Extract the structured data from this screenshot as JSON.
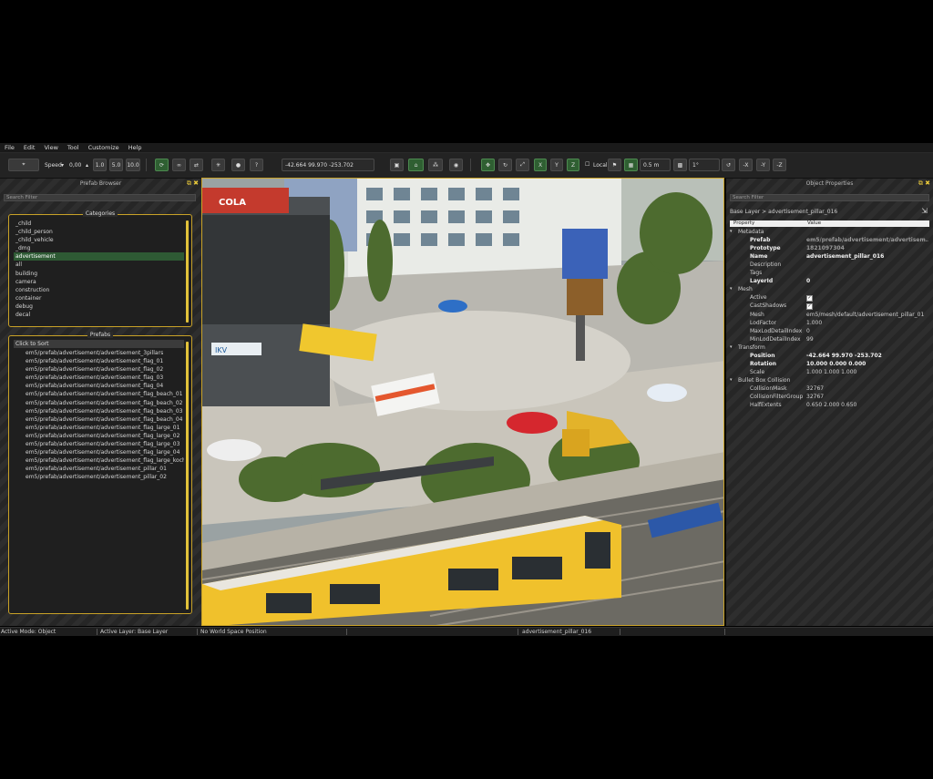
{
  "menu": [
    "File",
    "Edit",
    "View",
    "Tool",
    "Customize",
    "Help"
  ],
  "toolbar": {
    "speed_label": "Speed",
    "speed_value": "0,00",
    "speed_presets": [
      "1.0",
      "5.0",
      "10.0"
    ],
    "help": "?",
    "coords": "-42.664 99.970 -253.702",
    "axis_x": "X",
    "axis_y": "Y",
    "axis_z": "Z",
    "local_label": "Local",
    "grid_size": "0.5 m",
    "angle_snap": "1°",
    "neg_x": "-X",
    "neg_y": "-Y",
    "neg_z": "-Z"
  },
  "prefab_browser": {
    "title": "Prefab Browser",
    "search_placeholder": "Search Filter",
    "categories_title": "Categories",
    "categories": [
      "_child",
      "_child_person",
      "_child_vehicle",
      "_dmg",
      "advertisement",
      "all",
      "building",
      "camera",
      "construction",
      "container",
      "debug",
      "decal"
    ],
    "selected_category": "advertisement",
    "prefabs_title": "Prefabs",
    "sort_label": "Click to Sort",
    "prefabs": [
      "em5/prefab/advertisement/advertisement_3pillars",
      "em5/prefab/advertisement/advertisement_flag_01",
      "em5/prefab/advertisement/advertisement_flag_02",
      "em5/prefab/advertisement/advertisement_flag_03",
      "em5/prefab/advertisement/advertisement_flag_04",
      "em5/prefab/advertisement/advertisement_flag_beach_01",
      "em5/prefab/advertisement/advertisement_flag_beach_02",
      "em5/prefab/advertisement/advertisement_flag_beach_03",
      "em5/prefab/advertisement/advertisement_flag_beach_04",
      "em5/prefab/advertisement/advertisement_flag_large_01",
      "em5/prefab/advertisement/advertisement_flag_large_02",
      "em5/prefab/advertisement/advertisement_flag_large_03",
      "em5/prefab/advertisement/advertisement_flag_large_04",
      "em5/prefab/advertisement/advertisement_flag_large_koch",
      "em5/prefab/advertisement/advertisement_pillar_01",
      "em5/prefab/advertisement/advertisement_pillar_02"
    ]
  },
  "viewport": {
    "signs": {
      "cola": "COLA",
      "shop": "IKV"
    }
  },
  "object_properties": {
    "title": "Object Properties",
    "search_placeholder": "Search Filter",
    "breadcrumb": "Base Layer > advertisement_pillar_016",
    "col_property": "Property",
    "col_value": "Value",
    "rows": [
      {
        "type": "section",
        "key": "Metadata"
      },
      {
        "type": "prop",
        "key": "Prefab",
        "value": "em5/prefab/advertisement/advertisem...",
        "bold": true,
        "dim": true
      },
      {
        "type": "prop",
        "key": "Prototype",
        "value": "1821097304",
        "bold": true,
        "dim": true
      },
      {
        "type": "prop",
        "key": "Name",
        "value": "advertisement_pillar_016",
        "bold": true
      },
      {
        "type": "prop",
        "key": "Description",
        "value": ""
      },
      {
        "type": "prop",
        "key": "Tags",
        "value": ""
      },
      {
        "type": "prop",
        "key": "LayerId",
        "value": "0",
        "bold": true
      },
      {
        "type": "section",
        "key": "Mesh"
      },
      {
        "type": "prop",
        "key": "Active",
        "value": "✓",
        "check": true
      },
      {
        "type": "prop",
        "key": "CastShadows",
        "value": "✓",
        "check": true
      },
      {
        "type": "prop",
        "key": "Mesh",
        "value": "em5/mesh/default/advertisement_pillar_01"
      },
      {
        "type": "prop",
        "key": "LodFactor",
        "value": "1.000"
      },
      {
        "type": "prop",
        "key": "MaxLodDetailIndex",
        "value": "0"
      },
      {
        "type": "prop",
        "key": "MinLodDetailIndex",
        "value": "99"
      },
      {
        "type": "section",
        "key": "Transform"
      },
      {
        "type": "prop",
        "key": "Position",
        "value": "-42.664 99.970 -253.702",
        "bold": true
      },
      {
        "type": "prop",
        "key": "Rotation",
        "value": "10.000 0.000 0.000",
        "bold": true
      },
      {
        "type": "prop",
        "key": "Scale",
        "value": "1.000 1.000 1.000"
      },
      {
        "type": "section",
        "key": "Bullet Box Collision"
      },
      {
        "type": "prop",
        "key": "CollisionMask",
        "value": "32767"
      },
      {
        "type": "prop",
        "key": "CollisionFilterGroup",
        "value": "32767"
      },
      {
        "type": "prop",
        "key": "HalfExtents",
        "value": "0.650 2.000 0.650"
      }
    ]
  },
  "status": {
    "mode": "Active Mode: Object",
    "layer": "Active Layer: Base Layer",
    "world_pos": "No World Space Position",
    "selection": "advertisement_pillar_016"
  }
}
